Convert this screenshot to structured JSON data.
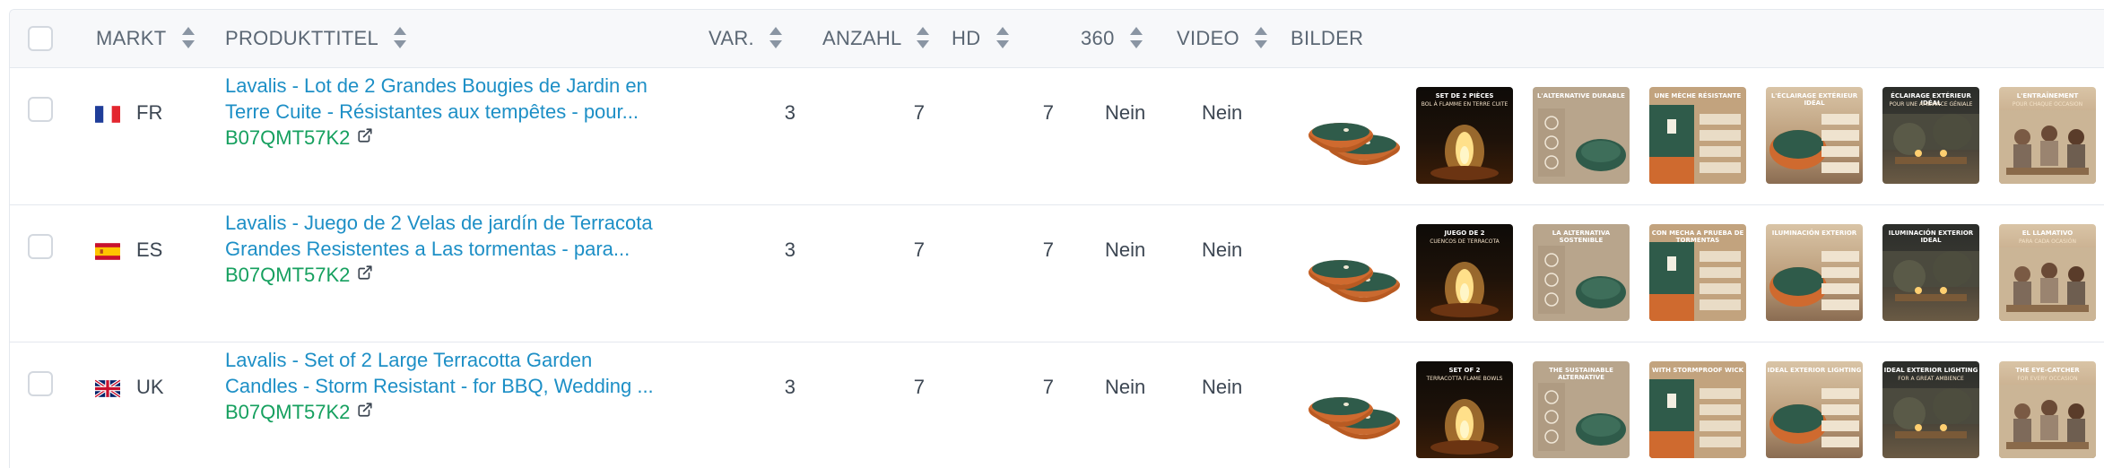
{
  "header": {
    "markt": "MARKT",
    "produkttitel": "PRODUKTTITEL",
    "var": "VAR.",
    "anzahl": "ANZAHL",
    "hd": "HD",
    "deg360": "360",
    "video": "VIDEO",
    "bilder": "BILDER"
  },
  "rows": [
    {
      "market": "FR",
      "flag": "france-flag",
      "title_line1": "Lavalis - Lot de 2 Grandes Bougies de Jardin en",
      "title_line2": "Terre Cuite - Résistantes aux tempêtes - pour...",
      "asin": "B07QMT57K2",
      "var": "3",
      "anzahl": "7",
      "hd": "7",
      "deg360": "Nein",
      "video": "Nein",
      "image_captions": [
        "SET DE 2 PIÈCES",
        "L'ALTERNATIVE DURABLE",
        "UNE MÈCHE RÉSISTANTE",
        "L'ÉCLAIRAGE EXTÉRIEUR IDÉAL",
        "ÉCLAIRAGE EXTÉRIEUR IDÉAL",
        "L'ENTRAÎNEMENT"
      ],
      "image_subcaptions": [
        "BOL À FLAMME EN TERRE CUITE",
        "",
        "",
        "",
        "POUR UNE AMBIANCE GÉNIALE",
        "POUR CHAQUE OCCASION"
      ]
    },
    {
      "market": "ES",
      "flag": "spain-flag",
      "title_line1": "Lavalis - Juego de 2 Velas de jardín de Terracota",
      "title_line2": "Grandes Resistentes a Las tormentas - para...",
      "asin": "B07QMT57K2",
      "var": "3",
      "anzahl": "7",
      "hd": "7",
      "deg360": "Nein",
      "video": "Nein",
      "image_captions": [
        "JUEGO DE 2",
        "LA ALTERNATIVA SOSTENIBLE",
        "CON MECHA A PRUEBA DE TORMENTAS",
        "ILUMINACIÓN EXTERIOR",
        "ILUMINACIÓN EXTERIOR IDEAL",
        "EL LLAMATIVO"
      ],
      "image_subcaptions": [
        "CUENCOS DE TERRACOTA",
        "",
        "",
        "",
        "",
        "PARA CADA OCASIÓN"
      ]
    },
    {
      "market": "UK",
      "flag": "uk-flag",
      "title_line1": "Lavalis - Set of 2 Large Terracotta Garden",
      "title_line2": "Candles - Storm Resistant - for BBQ, Wedding ...",
      "asin": "B07QMT57K2",
      "var": "3",
      "anzahl": "7",
      "hd": "7",
      "deg360": "Nein",
      "video": "Nein",
      "image_captions": [
        "SET OF 2",
        "THE SUSTAINABLE ALTERNATIVE",
        "WITH STORMPROOF WICK",
        "IDEAL EXTERIOR LIGHTING",
        "IDEAL EXTERIOR LIGHTING",
        "THE EYE-CATCHER"
      ],
      "image_subcaptions": [
        "TERRACOTTA FLAME BOWLS",
        "",
        "",
        "",
        "FOR A GREAT AMBIENCE",
        "FOR EVERY OCCASION"
      ]
    }
  ],
  "colors": {
    "link": "#1d8fc6",
    "asin": "#16a05f",
    "header_bg": "#f7f8fa",
    "border": "#e4e8ee",
    "bowl_green": "#2f5b4a",
    "terracotta": "#cf6a2f"
  }
}
